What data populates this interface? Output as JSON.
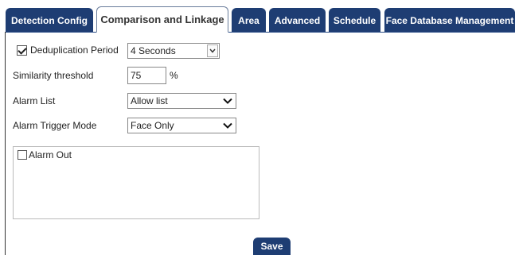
{
  "tabs": [
    {
      "label": "Detection Config"
    },
    {
      "label": "Comparison and Linkage"
    },
    {
      "label": "Area"
    },
    {
      "label": "Advanced"
    },
    {
      "label": "Schedule"
    },
    {
      "label": "Face Database Management"
    }
  ],
  "form": {
    "dedup": {
      "label": "Deduplication Period",
      "checked": true,
      "value": "4 Seconds"
    },
    "similarity": {
      "label": "Similarity threshold",
      "value": "75",
      "unit": "%"
    },
    "alarm_list": {
      "label": "Alarm List",
      "value": "Allow list"
    },
    "alarm_trigger": {
      "label": "Alarm Trigger Mode",
      "value": "Face Only"
    },
    "alarm_out": {
      "label": "Alarm Out",
      "checked": false
    }
  },
  "save_label": "Save",
  "colors": {
    "tab_bg": "#1e3d73",
    "tab_text": "#ffffff",
    "active_tab_bg": "#ffffff"
  }
}
